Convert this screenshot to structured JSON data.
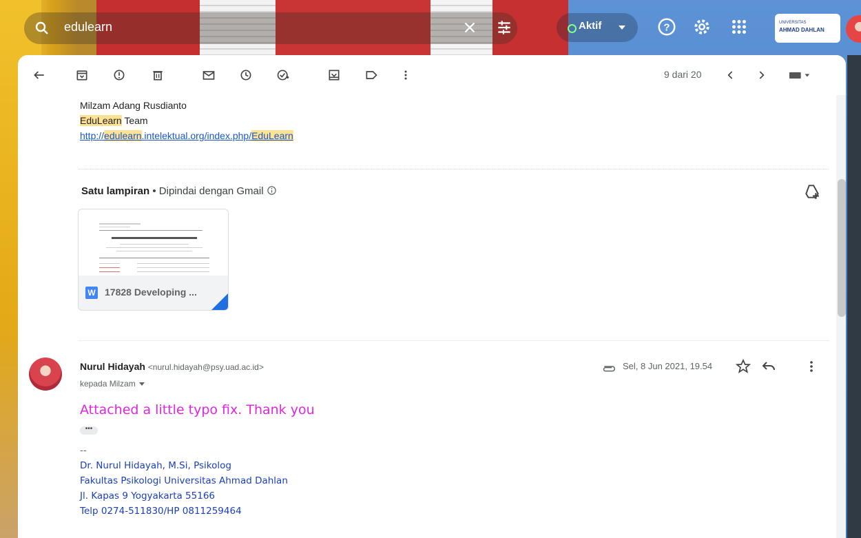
{
  "search": {
    "query": "edulearn"
  },
  "status": {
    "label": "Aktif"
  },
  "logo": {
    "small": "UNIVERSITAS",
    "name": "AHMAD DAHLAN"
  },
  "toolbar": {
    "pager": "9 dari 20"
  },
  "message1": {
    "sig_name": "Milzam Adang Rusdianto",
    "team_hl": "EduLearn",
    "team_rest": " Team",
    "link_a": "http://",
    "link_hl1": "edulearn",
    "link_b": ".intelektual.org/index.php/",
    "link_hl2": "EduLearn"
  },
  "attachments": {
    "title": "Satu lampiran",
    "sep": " • ",
    "scanned": "Dipindai dengan Gmail",
    "file_icon": "W",
    "file_name": "17828 Developing ..."
  },
  "message2": {
    "sender_name": "Nurul Hidayah",
    "sender_email": "<nurul.hidayah@psy.uad.ac.id>",
    "recipient": "kepada Milzam",
    "date": "Sel, 8 Jun 2021, 19.54",
    "body": "Attached a little typo fix. Thank you",
    "ellipsis": "•••",
    "sig_dash": "--",
    "sig_line1": "Dr. Nurul Hidayah, M.Si, Psikolog",
    "sig_line2": "Fakultas Psikologi Universitas Ahmad Dahlan",
    "sig_line3": "Jl. Kapas 9 Yogyakarta 55166",
    "sig_line4": "Telp 0274-511830/HP 0811259464"
  },
  "colors": {
    "accent": "#1a57c9",
    "highlight": "#fde293",
    "body_text": "#e026e0",
    "signature": "#1a3fbf"
  }
}
